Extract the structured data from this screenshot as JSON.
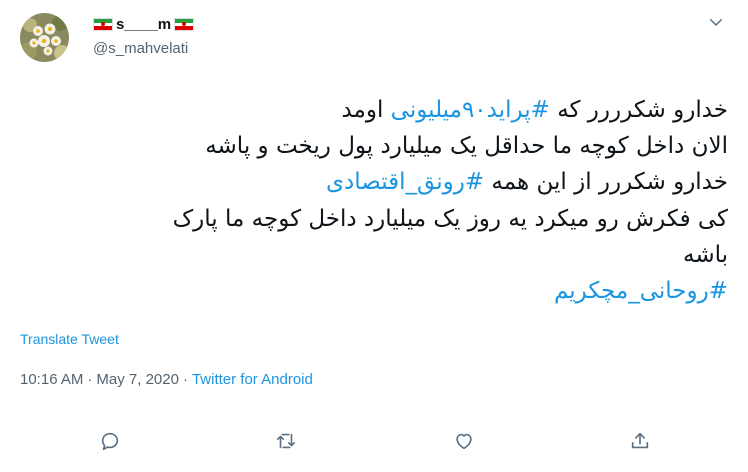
{
  "user": {
    "display_name_prefix": "s",
    "display_name_underline": "____",
    "display_name_suffix": "m",
    "handle": "@s_mahvelati"
  },
  "tweet": {
    "lines": [
      [
        {
          "text": "خدارو شکرررر که ",
          "hashtag": false
        },
        {
          "text": "#پراید۹۰میلیونی",
          "hashtag": true
        },
        {
          "text": " اومد",
          "hashtag": false
        }
      ],
      [
        {
          "text": "الان داخل کوچه ما حداقل یک میلیارد پول ریخت و پاشه",
          "hashtag": false
        }
      ],
      [
        {
          "text": "خدارو شکررر از این همه ",
          "hashtag": false
        },
        {
          "text": "#رونق_اقتصادی",
          "hashtag": true
        }
      ],
      [
        {
          "text": "کی فکرش رو میکرد یه روز یک میلیارد داخل کوچه ما پارک",
          "hashtag": false
        }
      ],
      [
        {
          "text": "باشه",
          "hashtag": false
        }
      ],
      [
        {
          "text": "#روحانی_مچکریم",
          "hashtag": true
        }
      ]
    ]
  },
  "translate_label": "Translate Tweet",
  "meta": {
    "time": "10:16 AM",
    "separator": "·",
    "date": "May 7, 2020",
    "source": "Twitter for Android"
  },
  "colors": {
    "link": "#1b95e0",
    "text": "#0f1419",
    "secondary": "#536471",
    "icon": "#5b7083"
  },
  "icons": [
    "reply-icon",
    "retweet-icon",
    "like-icon",
    "share-icon",
    "chevron-down-icon"
  ]
}
